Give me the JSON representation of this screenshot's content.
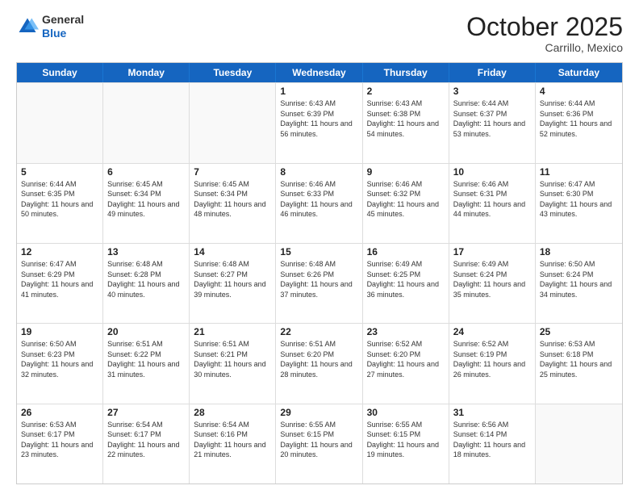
{
  "logo": {
    "general": "General",
    "blue": "Blue"
  },
  "header": {
    "month": "October 2025",
    "location": "Carrillo, Mexico"
  },
  "days_of_week": [
    "Sunday",
    "Monday",
    "Tuesday",
    "Wednesday",
    "Thursday",
    "Friday",
    "Saturday"
  ],
  "weeks": [
    [
      {
        "day": "",
        "empty": true
      },
      {
        "day": "",
        "empty": true
      },
      {
        "day": "",
        "empty": true
      },
      {
        "day": "1",
        "sunrise": "Sunrise: 6:43 AM",
        "sunset": "Sunset: 6:39 PM",
        "daylight": "Daylight: 11 hours and 56 minutes."
      },
      {
        "day": "2",
        "sunrise": "Sunrise: 6:43 AM",
        "sunset": "Sunset: 6:38 PM",
        "daylight": "Daylight: 11 hours and 54 minutes."
      },
      {
        "day": "3",
        "sunrise": "Sunrise: 6:44 AM",
        "sunset": "Sunset: 6:37 PM",
        "daylight": "Daylight: 11 hours and 53 minutes."
      },
      {
        "day": "4",
        "sunrise": "Sunrise: 6:44 AM",
        "sunset": "Sunset: 6:36 PM",
        "daylight": "Daylight: 11 hours and 52 minutes."
      }
    ],
    [
      {
        "day": "5",
        "sunrise": "Sunrise: 6:44 AM",
        "sunset": "Sunset: 6:35 PM",
        "daylight": "Daylight: 11 hours and 50 minutes."
      },
      {
        "day": "6",
        "sunrise": "Sunrise: 6:45 AM",
        "sunset": "Sunset: 6:34 PM",
        "daylight": "Daylight: 11 hours and 49 minutes."
      },
      {
        "day": "7",
        "sunrise": "Sunrise: 6:45 AM",
        "sunset": "Sunset: 6:34 PM",
        "daylight": "Daylight: 11 hours and 48 minutes."
      },
      {
        "day": "8",
        "sunrise": "Sunrise: 6:46 AM",
        "sunset": "Sunset: 6:33 PM",
        "daylight": "Daylight: 11 hours and 46 minutes."
      },
      {
        "day": "9",
        "sunrise": "Sunrise: 6:46 AM",
        "sunset": "Sunset: 6:32 PM",
        "daylight": "Daylight: 11 hours and 45 minutes."
      },
      {
        "day": "10",
        "sunrise": "Sunrise: 6:46 AM",
        "sunset": "Sunset: 6:31 PM",
        "daylight": "Daylight: 11 hours and 44 minutes."
      },
      {
        "day": "11",
        "sunrise": "Sunrise: 6:47 AM",
        "sunset": "Sunset: 6:30 PM",
        "daylight": "Daylight: 11 hours and 43 minutes."
      }
    ],
    [
      {
        "day": "12",
        "sunrise": "Sunrise: 6:47 AM",
        "sunset": "Sunset: 6:29 PM",
        "daylight": "Daylight: 11 hours and 41 minutes."
      },
      {
        "day": "13",
        "sunrise": "Sunrise: 6:48 AM",
        "sunset": "Sunset: 6:28 PM",
        "daylight": "Daylight: 11 hours and 40 minutes."
      },
      {
        "day": "14",
        "sunrise": "Sunrise: 6:48 AM",
        "sunset": "Sunset: 6:27 PM",
        "daylight": "Daylight: 11 hours and 39 minutes."
      },
      {
        "day": "15",
        "sunrise": "Sunrise: 6:48 AM",
        "sunset": "Sunset: 6:26 PM",
        "daylight": "Daylight: 11 hours and 37 minutes."
      },
      {
        "day": "16",
        "sunrise": "Sunrise: 6:49 AM",
        "sunset": "Sunset: 6:25 PM",
        "daylight": "Daylight: 11 hours and 36 minutes."
      },
      {
        "day": "17",
        "sunrise": "Sunrise: 6:49 AM",
        "sunset": "Sunset: 6:24 PM",
        "daylight": "Daylight: 11 hours and 35 minutes."
      },
      {
        "day": "18",
        "sunrise": "Sunrise: 6:50 AM",
        "sunset": "Sunset: 6:24 PM",
        "daylight": "Daylight: 11 hours and 34 minutes."
      }
    ],
    [
      {
        "day": "19",
        "sunrise": "Sunrise: 6:50 AM",
        "sunset": "Sunset: 6:23 PM",
        "daylight": "Daylight: 11 hours and 32 minutes."
      },
      {
        "day": "20",
        "sunrise": "Sunrise: 6:51 AM",
        "sunset": "Sunset: 6:22 PM",
        "daylight": "Daylight: 11 hours and 31 minutes."
      },
      {
        "day": "21",
        "sunrise": "Sunrise: 6:51 AM",
        "sunset": "Sunset: 6:21 PM",
        "daylight": "Daylight: 11 hours and 30 minutes."
      },
      {
        "day": "22",
        "sunrise": "Sunrise: 6:51 AM",
        "sunset": "Sunset: 6:20 PM",
        "daylight": "Daylight: 11 hours and 28 minutes."
      },
      {
        "day": "23",
        "sunrise": "Sunrise: 6:52 AM",
        "sunset": "Sunset: 6:20 PM",
        "daylight": "Daylight: 11 hours and 27 minutes."
      },
      {
        "day": "24",
        "sunrise": "Sunrise: 6:52 AM",
        "sunset": "Sunset: 6:19 PM",
        "daylight": "Daylight: 11 hours and 26 minutes."
      },
      {
        "day": "25",
        "sunrise": "Sunrise: 6:53 AM",
        "sunset": "Sunset: 6:18 PM",
        "daylight": "Daylight: 11 hours and 25 minutes."
      }
    ],
    [
      {
        "day": "26",
        "sunrise": "Sunrise: 6:53 AM",
        "sunset": "Sunset: 6:17 PM",
        "daylight": "Daylight: 11 hours and 23 minutes."
      },
      {
        "day": "27",
        "sunrise": "Sunrise: 6:54 AM",
        "sunset": "Sunset: 6:17 PM",
        "daylight": "Daylight: 11 hours and 22 minutes."
      },
      {
        "day": "28",
        "sunrise": "Sunrise: 6:54 AM",
        "sunset": "Sunset: 6:16 PM",
        "daylight": "Daylight: 11 hours and 21 minutes."
      },
      {
        "day": "29",
        "sunrise": "Sunrise: 6:55 AM",
        "sunset": "Sunset: 6:15 PM",
        "daylight": "Daylight: 11 hours and 20 minutes."
      },
      {
        "day": "30",
        "sunrise": "Sunrise: 6:55 AM",
        "sunset": "Sunset: 6:15 PM",
        "daylight": "Daylight: 11 hours and 19 minutes."
      },
      {
        "day": "31",
        "sunrise": "Sunrise: 6:56 AM",
        "sunset": "Sunset: 6:14 PM",
        "daylight": "Daylight: 11 hours and 18 minutes."
      },
      {
        "day": "",
        "empty": true
      }
    ]
  ]
}
